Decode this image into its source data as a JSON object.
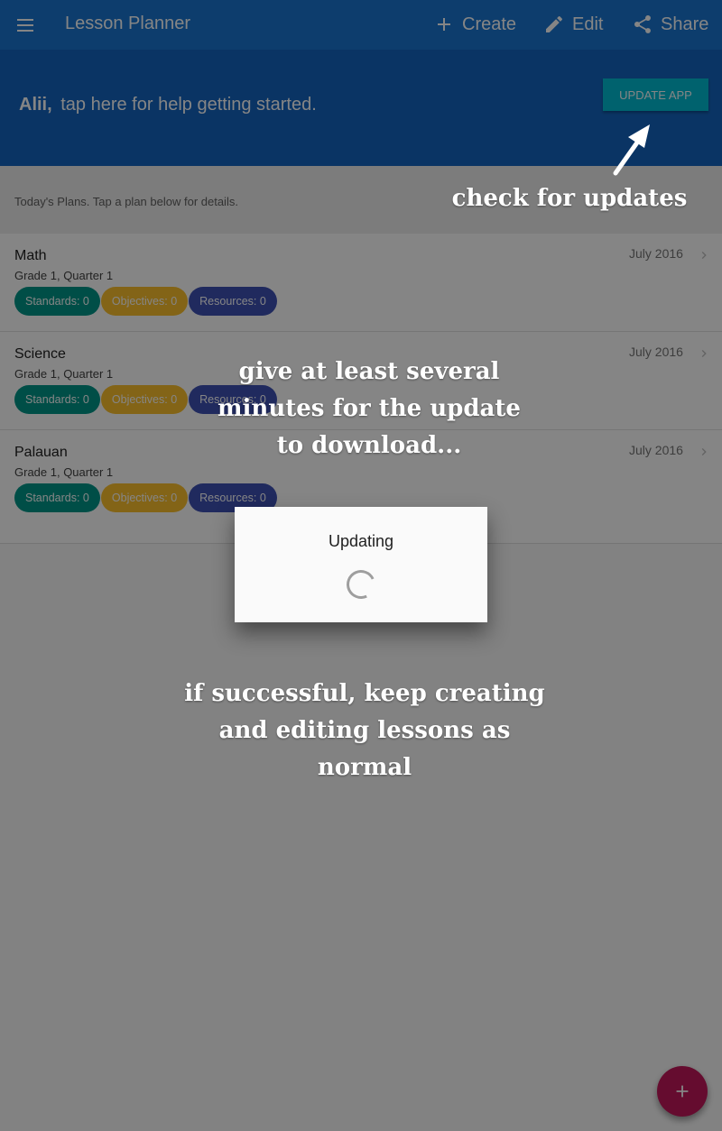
{
  "appbar": {
    "title": "Lesson Planner",
    "actions": {
      "create": "Create",
      "edit": "Edit",
      "share": "Share"
    }
  },
  "banner": {
    "user": "Alii,",
    "help_text": "tap here for help getting started.",
    "update_button": "UPDATE APP"
  },
  "subheader": "Today's Plans. Tap a plan below for details.",
  "plans": [
    {
      "name": "Math",
      "grade": "Grade 1, Quarter 1",
      "date": "July 2016",
      "standards": "Standards: 0",
      "objectives": "Objectives: 0",
      "resources": "Resources: 0"
    },
    {
      "name": "Science",
      "grade": "Grade 1, Quarter 1",
      "date": "July 2016",
      "standards": "Standards: 0",
      "objectives": "Objectives: 0",
      "resources": "Resources: 0"
    },
    {
      "name": "Palauan",
      "grade": "Grade 1, Quarter 1",
      "date": "July 2016",
      "standards": "Standards: 0",
      "objectives": "Objectives: 0",
      "resources": "Resources: 0"
    }
  ],
  "dialog": {
    "title": "Updating"
  },
  "annotations": {
    "check": "check for updates",
    "wait": "give at least several minutes for the update to download...",
    "success": "if successful, keep creating and editing lessons as normal"
  },
  "colors": {
    "appbar": "#1976d2",
    "banner": "#1565c0",
    "update_button": "#00bcd4",
    "standards_chip": "#009688",
    "objectives_chip": "#fbc02d",
    "resources_chip": "#3f51b5",
    "fab": "#c2185b"
  },
  "icons": [
    "menu-icon",
    "plus-icon",
    "pencil-icon",
    "share-icon",
    "chevron-right-icon",
    "arrow-icon"
  ]
}
